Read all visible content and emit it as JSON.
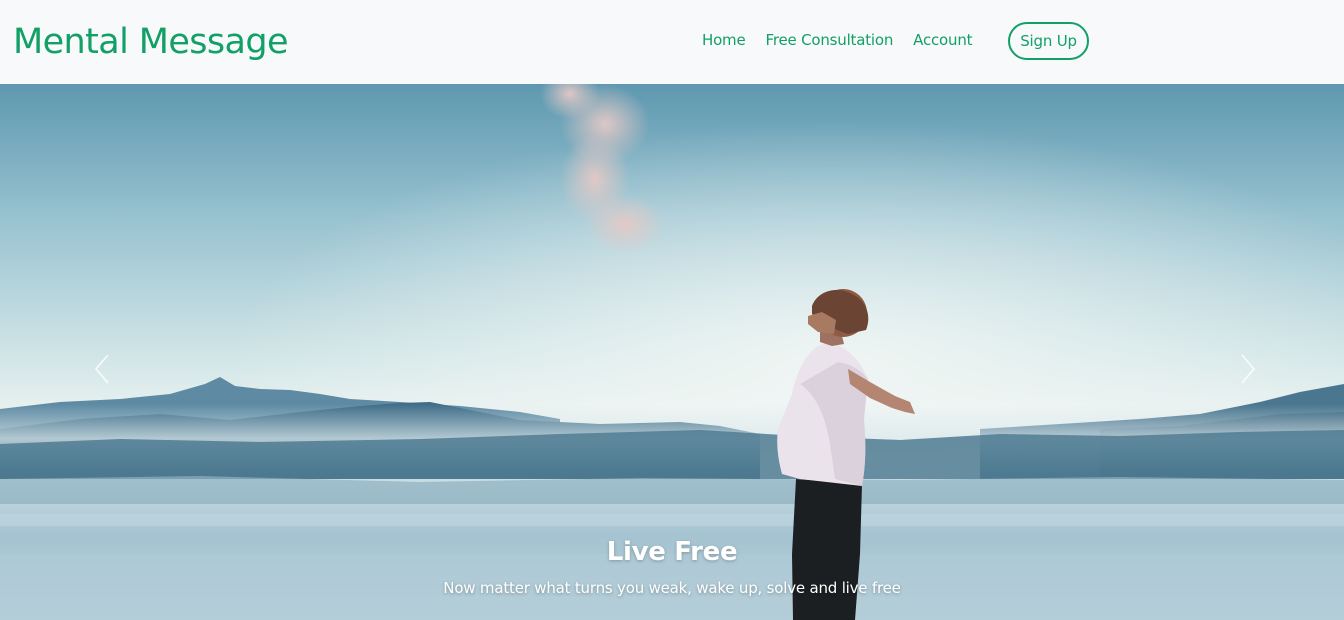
{
  "brand": {
    "name": "Mental Message"
  },
  "nav": {
    "home": "Home",
    "free_consultation": "Free Consultation",
    "account": "Account",
    "sign_up": "Sign Up"
  },
  "carousel": {
    "slide_title": "Live Free",
    "slide_text": "Now matter what turns you weak, wake up, solve and live free",
    "prev_icon": "chevron-left-icon",
    "next_icon": "chevron-right-icon"
  },
  "colors": {
    "accent": "#12a067",
    "navbar_bg": "#f8f9fa",
    "caption_text": "#ffffff"
  }
}
